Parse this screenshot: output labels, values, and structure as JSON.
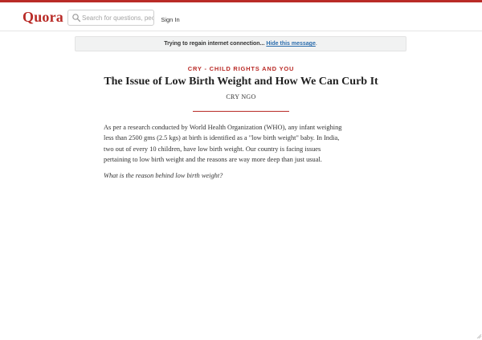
{
  "header": {
    "logo": "Quora",
    "search_placeholder": "Search for questions, peop",
    "signin_label": "Sign In"
  },
  "banner": {
    "text": "Trying to regain internet connection...",
    "link": "Hide this message",
    "suffix": "."
  },
  "article": {
    "topic": "CRY - CHILD RIGHTS AND YOU",
    "title": "The Issue of Low Birth Weight and How We Can Curb It",
    "author": "CRY NGO",
    "paragraph_lines": [
      "As per a research conducted by World Health Organization (WHO), any infant weighing",
      "less than 2500 gms (2.5 kgs) at birth is identified as a \"low birth weight\" baby. In India,",
      "two out of every 10 children, have low birth weight. Our country is facing issues",
      "pertaining to low birth weight and the reasons are way more deep than just usual."
    ],
    "subheading": "What is the reason behind low birth weight?"
  },
  "colors": {
    "brand": "#b92b27",
    "link": "#2b6dad"
  },
  "icons": {
    "search": "search-icon",
    "resize": "resize-grip-icon"
  }
}
